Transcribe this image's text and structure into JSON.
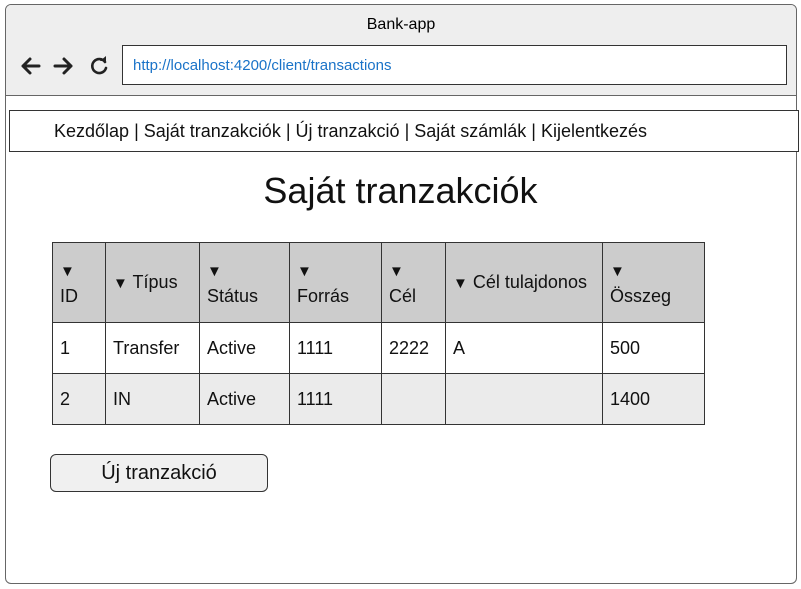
{
  "window": {
    "title": "Bank-app"
  },
  "browser": {
    "url": "http://localhost:4200/client/transactions",
    "icons": [
      "arrow-left-icon",
      "arrow-right-icon",
      "reload-icon"
    ]
  },
  "menu": {
    "items": [
      {
        "label": "Kezdőlap"
      },
      {
        "label": "Saját tranzakciók"
      },
      {
        "label": "Új tranzakció"
      },
      {
        "label": "Saját számlák"
      },
      {
        "label": "Kijelentkezés"
      }
    ],
    "separator": "|"
  },
  "page": {
    "title": "Saját tranzakciók"
  },
  "table": {
    "sort_icon": "▼",
    "columns": [
      {
        "label": "ID"
      },
      {
        "label": "Típus"
      },
      {
        "label": "Státus"
      },
      {
        "label": "Forrás"
      },
      {
        "label": "Cél"
      },
      {
        "label": "Cél tulajdonos"
      },
      {
        "label": "Összeg"
      }
    ],
    "rows": [
      [
        "1",
        "Transfer",
        "Active",
        "1111",
        "2222",
        "A",
        "500"
      ],
      [
        "2",
        "IN",
        "Active",
        "1111",
        "",
        "",
        "1400"
      ]
    ]
  },
  "actions": {
    "new_transaction_label": "Új tranzakció"
  },
  "colors": {
    "url_text": "#1a73c8",
    "header_bg": "#cccccc",
    "alt_row_bg": "#ebebeb",
    "chrome_bg": "#eeeeee"
  }
}
